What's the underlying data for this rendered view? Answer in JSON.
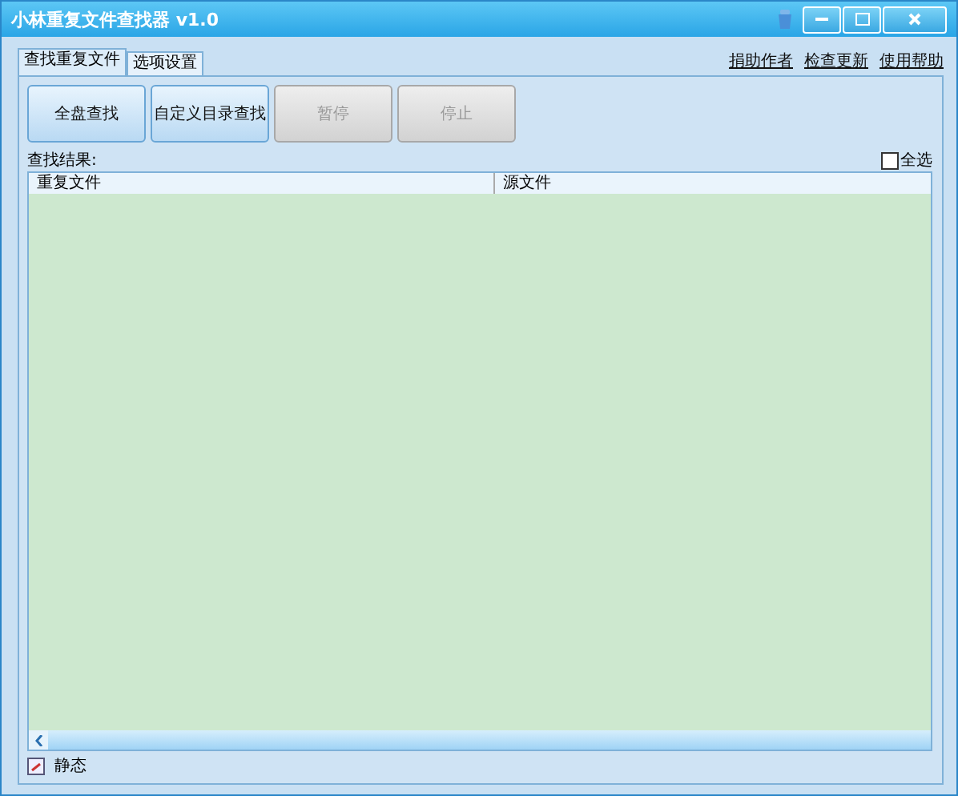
{
  "window": {
    "title": "小林重复文件查找器 v1.0"
  },
  "tabs": [
    {
      "label": "查找重复文件",
      "selected": true
    },
    {
      "label": "选项设置",
      "selected": false
    }
  ],
  "links": [
    "捐助作者",
    "检查更新",
    "使用帮助"
  ],
  "buttons": [
    {
      "label": "全盘查找",
      "disabled": false
    },
    {
      "label": "自定义目录查找",
      "disabled": false
    },
    {
      "label": "暂停",
      "disabled": true
    },
    {
      "label": "停止",
      "disabled": true
    }
  ],
  "results": {
    "label": "查找结果:",
    "select_all": {
      "label": "全选",
      "checked": false
    },
    "columns": [
      "重复文件",
      "源文件"
    ]
  },
  "status_bar": {
    "text": "静态"
  }
}
